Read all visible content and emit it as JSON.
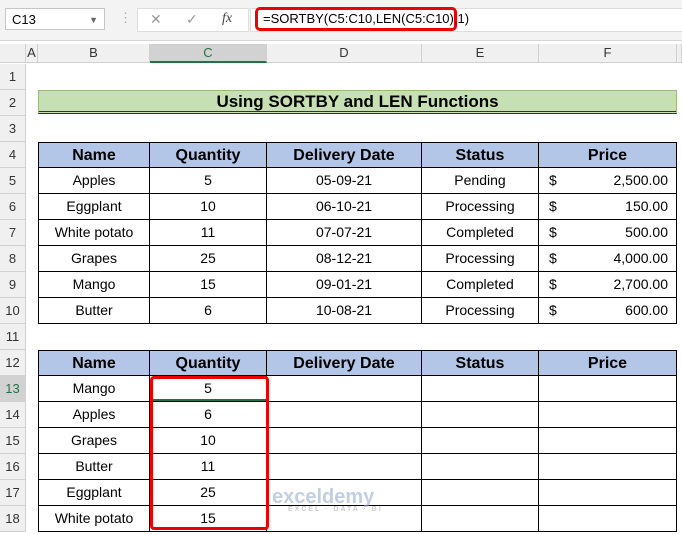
{
  "formula_bar": {
    "name_box": "C13",
    "cancel_icon": "✕",
    "enter_icon": "✓",
    "fx_label": "fx",
    "formula": "=SORTBY(C5:C10,LEN(C5:C10),1)"
  },
  "columns": [
    "A",
    "B",
    "C",
    "D",
    "E",
    "F"
  ],
  "rows": [
    "1",
    "2",
    "3",
    "4",
    "5",
    "6",
    "7",
    "8",
    "9",
    "10",
    "11",
    "12",
    "13",
    "14",
    "15",
    "16",
    "17",
    "18"
  ],
  "title": "Using SORTBY and LEN Functions",
  "headers": [
    "Name",
    "Quantity",
    "Delivery Date",
    "Status",
    "Price"
  ],
  "table1": [
    [
      "Apples",
      "5",
      "05-09-21",
      "Pending",
      "$",
      "2,500.00"
    ],
    [
      "Eggplant",
      "10",
      "06-10-21",
      "Processing",
      "$",
      "150.00"
    ],
    [
      "White potato",
      "11",
      "07-07-21",
      "Completed",
      "$",
      "500.00"
    ],
    [
      "Grapes",
      "25",
      "08-12-21",
      "Processing",
      "$",
      "4,000.00"
    ],
    [
      "Mango",
      "15",
      "09-01-21",
      "Completed",
      "$",
      "2,700.00"
    ],
    [
      "Butter",
      "6",
      "10-08-21",
      "Processing",
      "$",
      "600.00"
    ]
  ],
  "table2": [
    [
      "Mango",
      "5"
    ],
    [
      "Apples",
      "6"
    ],
    [
      "Grapes",
      "10"
    ],
    [
      "Butter",
      "11"
    ],
    [
      "Eggplant",
      "25"
    ],
    [
      "White potato",
      "15"
    ]
  ],
  "watermark": {
    "name": "exceldemy",
    "tagline": "EXCEL · DATA · BI"
  },
  "colors": {
    "highlight": "#e00000",
    "header_fill": "#b4c6e7",
    "title_fill": "#c6e0b4",
    "selection": "#217346"
  }
}
